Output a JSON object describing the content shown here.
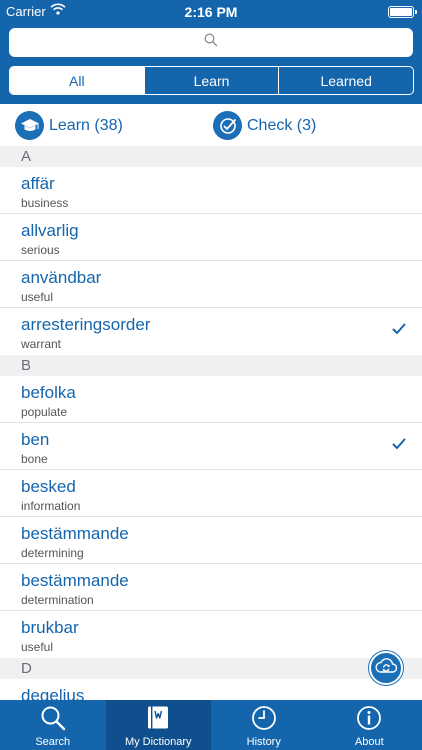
{
  "status_bar": {
    "carrier": "Carrier",
    "time": "2:16 PM"
  },
  "search": {
    "placeholder": ""
  },
  "segments": [
    {
      "label": "All",
      "active": true
    },
    {
      "label": "Learn",
      "active": false
    },
    {
      "label": "Learned",
      "active": false
    }
  ],
  "actions": {
    "learn_label": "Learn (38)",
    "check_label": "Check (3)"
  },
  "sections": {
    "a": "A",
    "b": "B",
    "d": "D"
  },
  "entries": [
    {
      "word": "affär",
      "translation": "business",
      "checked": false
    },
    {
      "word": "allvarlig",
      "translation": "serious",
      "checked": false
    },
    {
      "word": "användbar",
      "translation": "useful",
      "checked": false
    },
    {
      "word": "arresteringsorder",
      "translation": "warrant",
      "checked": true
    },
    {
      "word": "befolka",
      "translation": "populate",
      "checked": false
    },
    {
      "word": "ben",
      "translation": "bone",
      "checked": true
    },
    {
      "word": "besked",
      "translation": "information",
      "checked": false
    },
    {
      "word": "bestämmande",
      "translation": "determining",
      "checked": false
    },
    {
      "word": "bestämmande",
      "translation": "determination",
      "checked": false
    },
    {
      "word": "brukbar",
      "translation": "useful",
      "checked": false
    },
    {
      "word": "degeljus",
      "translation": "",
      "checked": false
    }
  ],
  "tabs": [
    {
      "label": "Search",
      "icon": "magnifier-icon"
    },
    {
      "label": "My Dictionary",
      "icon": "dictionary-book-icon"
    },
    {
      "label": "History",
      "icon": "clock-icon"
    },
    {
      "label": "About",
      "icon": "info-icon"
    }
  ],
  "colors": {
    "primary": "#1565ad",
    "active_tab": "#0f4f8e",
    "section_bg": "#f0f0f2"
  }
}
